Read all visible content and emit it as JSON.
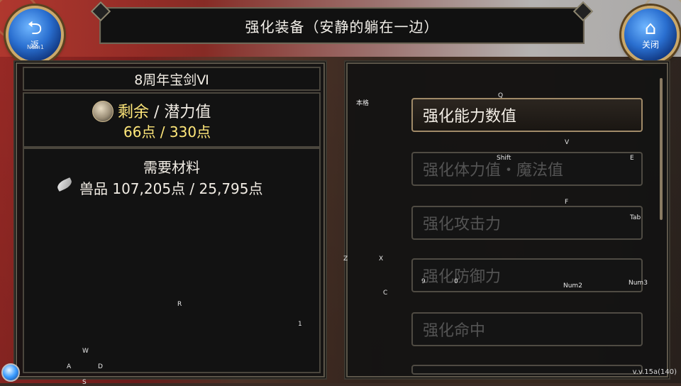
{
  "title": "强化装备（安静的躺在一边）",
  "back_button": {
    "label": "返",
    "hint": "Num1"
  },
  "close_button": {
    "label": "关闭"
  },
  "item_name": "8周年宝剑Ⅵ",
  "potential": {
    "label_remaining": "剩余",
    "separator": " / ",
    "label_potential": "潜力值",
    "remaining_value": "66点",
    "potential_value": "330点"
  },
  "materials": {
    "title": "需要材料",
    "material_name": "兽品",
    "amount_text": "107,205点 / 25,795点"
  },
  "options": [
    {
      "label": "强化能力数值",
      "active": true
    },
    {
      "label": "强化体力值・魔法值",
      "active": false
    },
    {
      "label": "强化攻击力",
      "active": false
    },
    {
      "label": "强化防御力",
      "active": false
    },
    {
      "label": "强化命中",
      "active": false
    }
  ],
  "key_hints": {
    "q": "Q",
    "v": "V",
    "shift": "Shift",
    "e": "E",
    "f": "F",
    "tab": "Tab",
    "r": "R",
    "one": "1",
    "z": "Z",
    "x": "X",
    "c": "C",
    "nine": "9",
    "zero": "0",
    "num2": "Num2",
    "num3": "Num3",
    "w": "W",
    "a": "A",
    "s": "S",
    "d": "D",
    "misc": "本格"
  },
  "version": "v.v.15a(140)"
}
